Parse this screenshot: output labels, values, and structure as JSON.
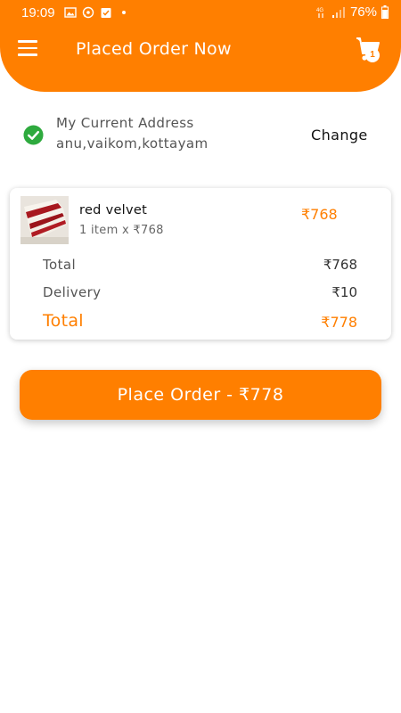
{
  "status_bar": {
    "time": "19:09",
    "battery": "76%",
    "network": "4G"
  },
  "header": {
    "title": "Placed Order Now",
    "cart_count": "1"
  },
  "address": {
    "label": "My Current Address",
    "value": "anu,vaikom,kottayam",
    "change_label": "Change"
  },
  "order": {
    "item_name": "red velvet",
    "item_qty_text": "1 item x ₹768",
    "item_price": "₹768",
    "total_label": "Total",
    "total_value": "₹768",
    "delivery_label": "Delivery",
    "delivery_value": "₹10",
    "grand_total_label": "Total",
    "grand_total_value": "₹778"
  },
  "place_order_button": "Place Order - ₹778",
  "colors": {
    "accent": "#ff7f00",
    "check": "#2eaa3e"
  },
  "icons": [
    "menu-icon",
    "cart-icon",
    "check-circle-icon",
    "gallery-icon",
    "whatsapp-icon",
    "calendar-check-icon",
    "wifi-icon",
    "signal-icon",
    "battery-icon"
  ]
}
